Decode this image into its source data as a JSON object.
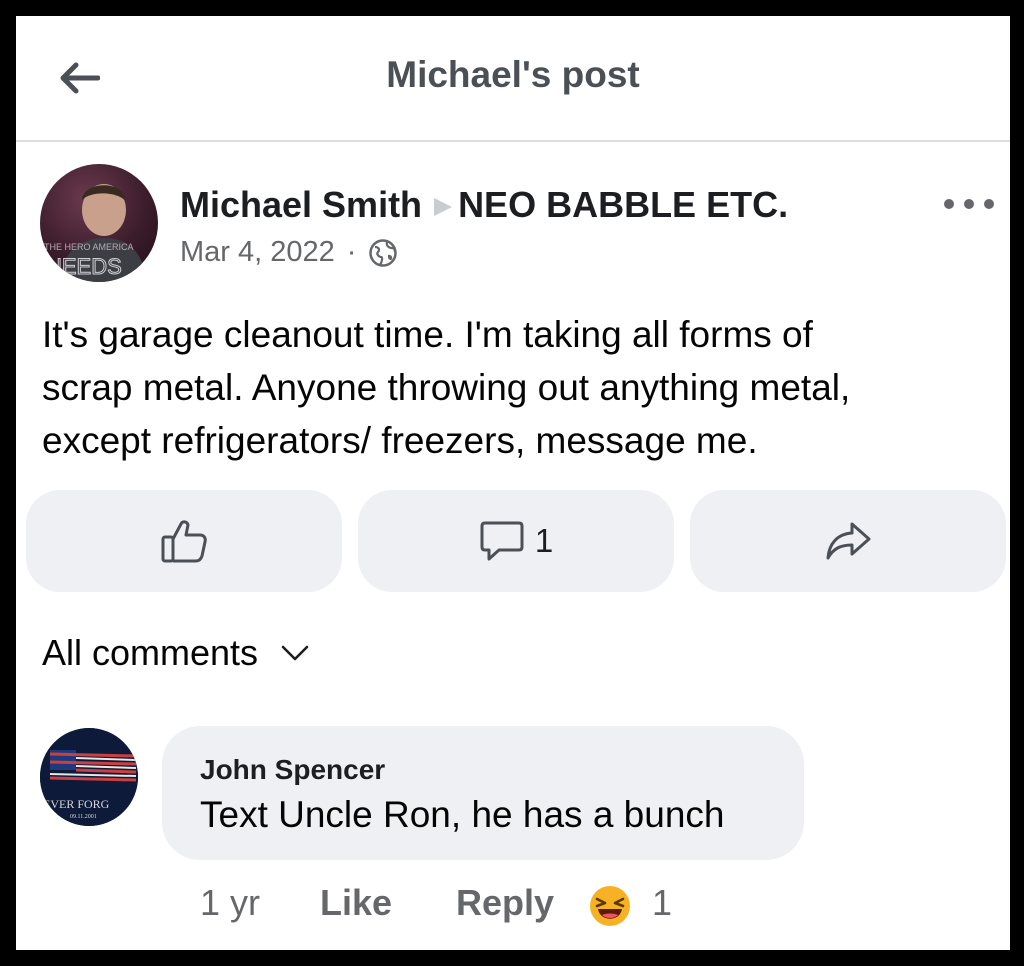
{
  "header": {
    "title": "Michael's post",
    "back_icon": "back-arrow-icon"
  },
  "post": {
    "author": "Michael Smith",
    "group": "NEO BABBLE ETC.",
    "date": "Mar 4, 2022",
    "separator": "·",
    "privacy_icon": "globe-icon",
    "avatar_text": "NEEDS",
    "avatar_small_text": "THE HERO AMERICA",
    "text_lines": [
      "It's garage cleanout time. I'm taking all forms of",
      "scrap metal. Anyone throwing out anything metal,",
      "except refrigerators/ freezers,  message me."
    ]
  },
  "actions": {
    "like_icon": "thumbs-up-icon",
    "comment_icon": "comment-icon",
    "comment_count": "1",
    "share_icon": "share-icon"
  },
  "comments": {
    "filter_label": "All comments",
    "items": [
      {
        "author": "John Spencer",
        "text": "Text Uncle Ron, he has a bunch",
        "avatar_text": "EVER FORG",
        "avatar_date": "09.11.2001",
        "age": "1 yr",
        "like_label": "Like",
        "reply_label": "Reply",
        "reaction_icon": "laughing-emoji-icon",
        "reaction_count": "1"
      }
    ]
  },
  "colors": {
    "secondary_text": "#65676b",
    "button_bg": "#eff0f3",
    "divider": "#dadde1",
    "reaction_yellow": "#f7b125"
  }
}
